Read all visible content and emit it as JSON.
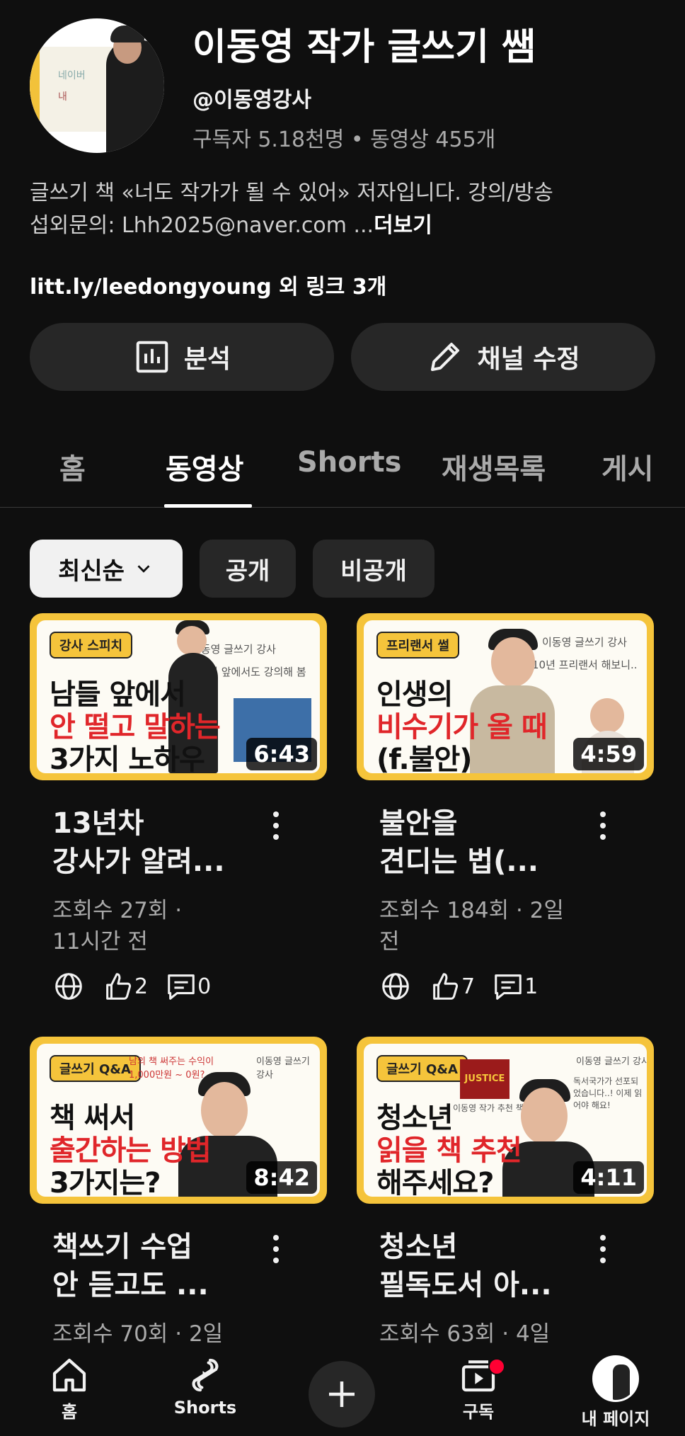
{
  "channel": {
    "name": "이동영 작가 글쓰기 쌤",
    "handle": "@이동영강사",
    "stats": "구독자 5.18천명 • 동영상 455개",
    "description_line1": "글쓰기 책 «너도 작가가 될 수 있어» 저자입니다. 강의/방송",
    "description_line2": "섭외문의: Lhh2025@naver.com ...",
    "more_label": "더보기",
    "links": "litt.ly/leedongyoung 외 링크 3개",
    "avatar_text1": "네이버",
    "avatar_text2": "내"
  },
  "actions": {
    "analytics_label": "분석",
    "edit_label": "채널 수정"
  },
  "tabs": [
    "홈",
    "동영상",
    "Shorts",
    "재생목록",
    "게시"
  ],
  "active_tab": "동영상",
  "filters": {
    "sort_label": "최신순",
    "public_label": "공개",
    "private_label": "비공개"
  },
  "videos": [
    {
      "thumb_tag": "강사 스피치",
      "thumb_line1": "남들 앞에서",
      "thumb_line2": "안 떨고 말하는",
      "thumb_line3": "3가지 노하우",
      "thumb_note": "1000명 앞에서도 강의해 봄",
      "thumb_brand": "이동영 글쓰기 강사",
      "duration": "6:43",
      "title_line1": "13년차",
      "title_line2": "강사가 알려...",
      "meta_line1": "조회수 27회 ·",
      "meta_line2": "11시간 전",
      "likes": "2",
      "comments": "0"
    },
    {
      "thumb_tag": "프리랜서 썰",
      "thumb_line1": "인생의",
      "thumb_line2": "비수기가 올 때",
      "thumb_line3": "(f.불안)",
      "thumb_note": "10년 프리랜서 해보니..",
      "thumb_brand": "이동영 글쓰기 강사",
      "duration": "4:59",
      "title_line1": "불안을",
      "title_line2": "견디는 법(...",
      "meta_line1": "조회수 184회 · 2일",
      "meta_line2": "전",
      "likes": "7",
      "comments": "1"
    },
    {
      "thumb_tag": "글쓰기 Q&A",
      "thumb_line1": "책 써서",
      "thumb_line2": "출간하는 방법",
      "thumb_line3": "3가지는?",
      "thumb_note": "남의 책 써주는 수익이 1,000만원 ~ 0원?",
      "thumb_brand": "이동영 글쓰기 강사",
      "duration": "8:42",
      "title_line1": "책쓰기 수업",
      "title_line2": "안 듣고도 ...",
      "meta_line1": "조회수 70회 · 2일"
    },
    {
      "thumb_tag": "글쓰기 Q&A",
      "thumb_line1": "청소년",
      "thumb_line2": "읽을 책 추천",
      "thumb_line3": "해주세요?",
      "thumb_note": "독서국가가 선포되었습니다..! 이제 읽어야 해요!",
      "thumb_brand": "이동영 글쓰기 강사",
      "thumb_book": "JUSTICE",
      "thumb_book_caption": "이동영 작가 추천 책",
      "duration": "4:11",
      "title_line1": "청소년",
      "title_line2": "필독도서 아...",
      "meta_line1": "조회수 63회 · 4일"
    }
  ],
  "bottom_nav": {
    "home": "홈",
    "shorts": "Shorts",
    "subscriptions": "구독",
    "you": "내 페이지"
  }
}
